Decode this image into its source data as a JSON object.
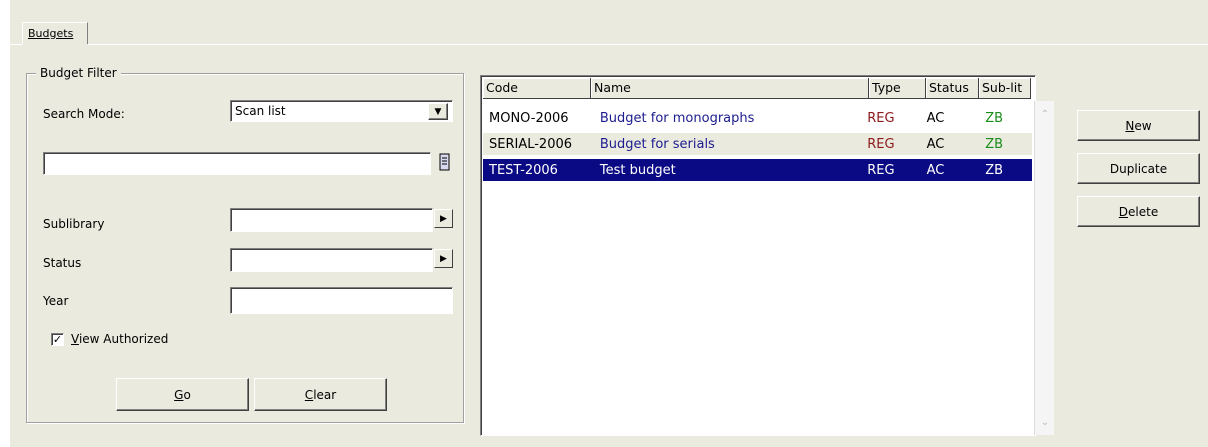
{
  "tabs": [
    {
      "label": "Budgets"
    }
  ],
  "filter": {
    "title": "Budget Filter",
    "search_mode_label": "Search Mode:",
    "search_mode_value": "Scan list",
    "search_text_value": "",
    "sublibrary_label": "Sublibrary",
    "sublibrary_value": "",
    "status_label": "Status",
    "status_value": "",
    "year_label": "Year",
    "year_value": "",
    "view_authorized_label": "View Authorized",
    "view_authorized_checked": true,
    "go_label": "Go",
    "clear_label": "Clear"
  },
  "list": {
    "columns": [
      "Code",
      "Name",
      "Type",
      "Status",
      "Sub-lit"
    ],
    "rows": [
      {
        "code": "MONO-2006",
        "name": "Budget for monographs",
        "type": "REG",
        "status": "AC",
        "sub": "ZB"
      },
      {
        "code": "SERIAL-2006",
        "name": "Budget for serials",
        "type": "REG",
        "status": "AC",
        "sub": "ZB"
      },
      {
        "code": "TEST-2006",
        "name": "Test budget",
        "type": "REG",
        "status": "AC",
        "sub": "ZB"
      }
    ],
    "selected_row": 2
  },
  "actions": {
    "new_label": "New",
    "duplicate_label": "Duplicate",
    "delete_label": "Delete"
  },
  "colors": {
    "selection": "#0a0a84",
    "name_text": "#1c1c8e",
    "type_text": "#8b1a1a",
    "sub_text": "#1a8c1a",
    "panel_bg": "#ebeadf"
  }
}
